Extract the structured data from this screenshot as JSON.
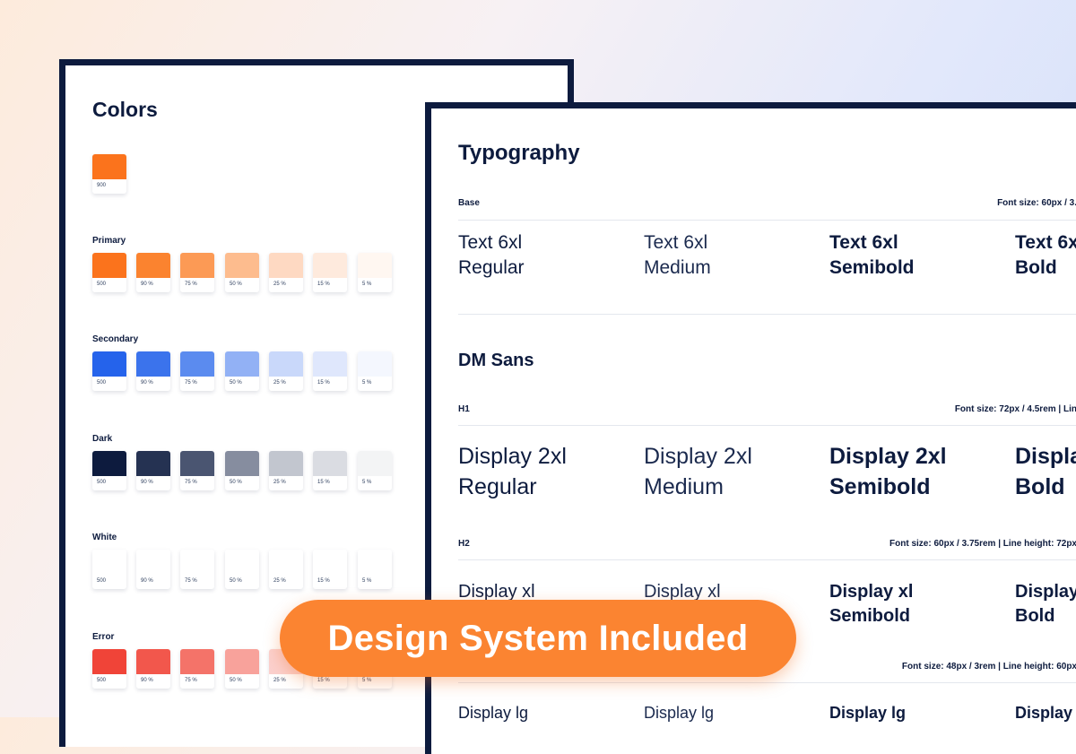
{
  "colors_panel": {
    "title": "Colors",
    "brand": {
      "color": "#fb731c",
      "label": "900"
    },
    "groups": [
      {
        "label": "Primary",
        "swatches": [
          {
            "label": "500",
            "color": "#fb731c"
          },
          {
            "label": "90 %",
            "color": "#fb832f"
          },
          {
            "label": "75 %",
            "color": "#fc9a55"
          },
          {
            "label": "50 %",
            "color": "#fdbc8e"
          },
          {
            "label": "25 %",
            "color": "#fed9c2"
          },
          {
            "label": "15 %",
            "color": "#feeadd"
          },
          {
            "label": "5 %",
            "color": "#fff7f1"
          }
        ]
      },
      {
        "label": "Secondary",
        "swatches": [
          {
            "label": "500",
            "color": "#2563eb"
          },
          {
            "label": "90 %",
            "color": "#3b73ec"
          },
          {
            "label": "75 %",
            "color": "#5b8bef"
          },
          {
            "label": "50 %",
            "color": "#92b1f5"
          },
          {
            "label": "25 %",
            "color": "#c9d8fa"
          },
          {
            "label": "15 %",
            "color": "#dfe7fc"
          },
          {
            "label": "5 %",
            "color": "#f4f7fe"
          }
        ]
      },
      {
        "label": "Dark",
        "swatches": [
          {
            "label": "500",
            "color": "#0d1b3e"
          },
          {
            "label": "90 %",
            "color": "#253252"
          },
          {
            "label": "75 %",
            "color": "#4a5571"
          },
          {
            "label": "50 %",
            "color": "#868d9f"
          },
          {
            "label": "25 %",
            "color": "#c2c6cf"
          },
          {
            "label": "15 %",
            "color": "#dadce2"
          },
          {
            "label": "5 %",
            "color": "#f3f4f5"
          }
        ]
      },
      {
        "label": "White",
        "swatches": [
          {
            "label": "500",
            "color": "#ffffff"
          },
          {
            "label": "90 %",
            "color": "#ffffff"
          },
          {
            "label": "75 %",
            "color": "#ffffff"
          },
          {
            "label": "50 %",
            "color": "#ffffff"
          },
          {
            "label": "25 %",
            "color": "#ffffff"
          },
          {
            "label": "15 %",
            "color": "#ffffff"
          },
          {
            "label": "5 %",
            "color": "#ffffff"
          }
        ]
      },
      {
        "label": "Error",
        "swatches": [
          {
            "label": "500",
            "color": "#f04438"
          },
          {
            "label": "90 %",
            "color": "#f2574c"
          },
          {
            "label": "75 %",
            "color": "#f47369"
          },
          {
            "label": "50 %",
            "color": "#f8a29b"
          },
          {
            "label": "25 %",
            "color": "#fbd0cd"
          },
          {
            "label": "15 %",
            "color": "#fde3e1"
          },
          {
            "label": "5 %",
            "color": "#fef6f5"
          }
        ]
      }
    ]
  },
  "typography_panel": {
    "title": "Typography",
    "base": {
      "label": "Base",
      "spec": "Font size: 60px / 3.",
      "samples": [
        {
          "line1": "Text 6xl",
          "line2": "Regular",
          "weight": "400"
        },
        {
          "line1": "Text 6xl",
          "line2": "Medium",
          "weight": "500"
        },
        {
          "line1": "Text 6xl",
          "line2": "Semibold",
          "weight": "600"
        },
        {
          "line1": "Text 6x",
          "line2": "Bold",
          "weight": "700"
        }
      ]
    },
    "family_title": "DM Sans",
    "h1": {
      "label": "H1",
      "spec": "Font size: 72px / 4.5rem | Lin",
      "samples": [
        {
          "line1": "Display 2xl",
          "line2": "Regular",
          "weight": "400"
        },
        {
          "line1": "Display 2xl",
          "line2": "Medium",
          "weight": "500"
        },
        {
          "line1": "Display 2xl",
          "line2": "Semibold",
          "weight": "600"
        },
        {
          "line1": "Displa",
          "line2": "Bold",
          "weight": "700"
        }
      ]
    },
    "h2": {
      "label": "H2",
      "spec": "Font size: 60px / 3.75rem | Line height: 72px",
      "samples": [
        {
          "line1": "Display xl",
          "line2": "",
          "weight": "400"
        },
        {
          "line1": "Display xl",
          "line2": "",
          "weight": "500"
        },
        {
          "line1": "Display xl",
          "line2": "Semibold",
          "weight": "600"
        },
        {
          "line1": "Display",
          "line2": "Bold",
          "weight": "700"
        }
      ]
    },
    "h3": {
      "spec": "Font size: 48px / 3rem | Line height: 60px",
      "samples": [
        {
          "line1": "Display lg",
          "weight": "400"
        },
        {
          "line1": "Display lg",
          "weight": "500"
        },
        {
          "line1": "Display lg",
          "weight": "600"
        },
        {
          "line1": "Display l",
          "weight": "700"
        }
      ]
    }
  },
  "badge": {
    "label": "Design System Included",
    "color": "#fb8431"
  }
}
